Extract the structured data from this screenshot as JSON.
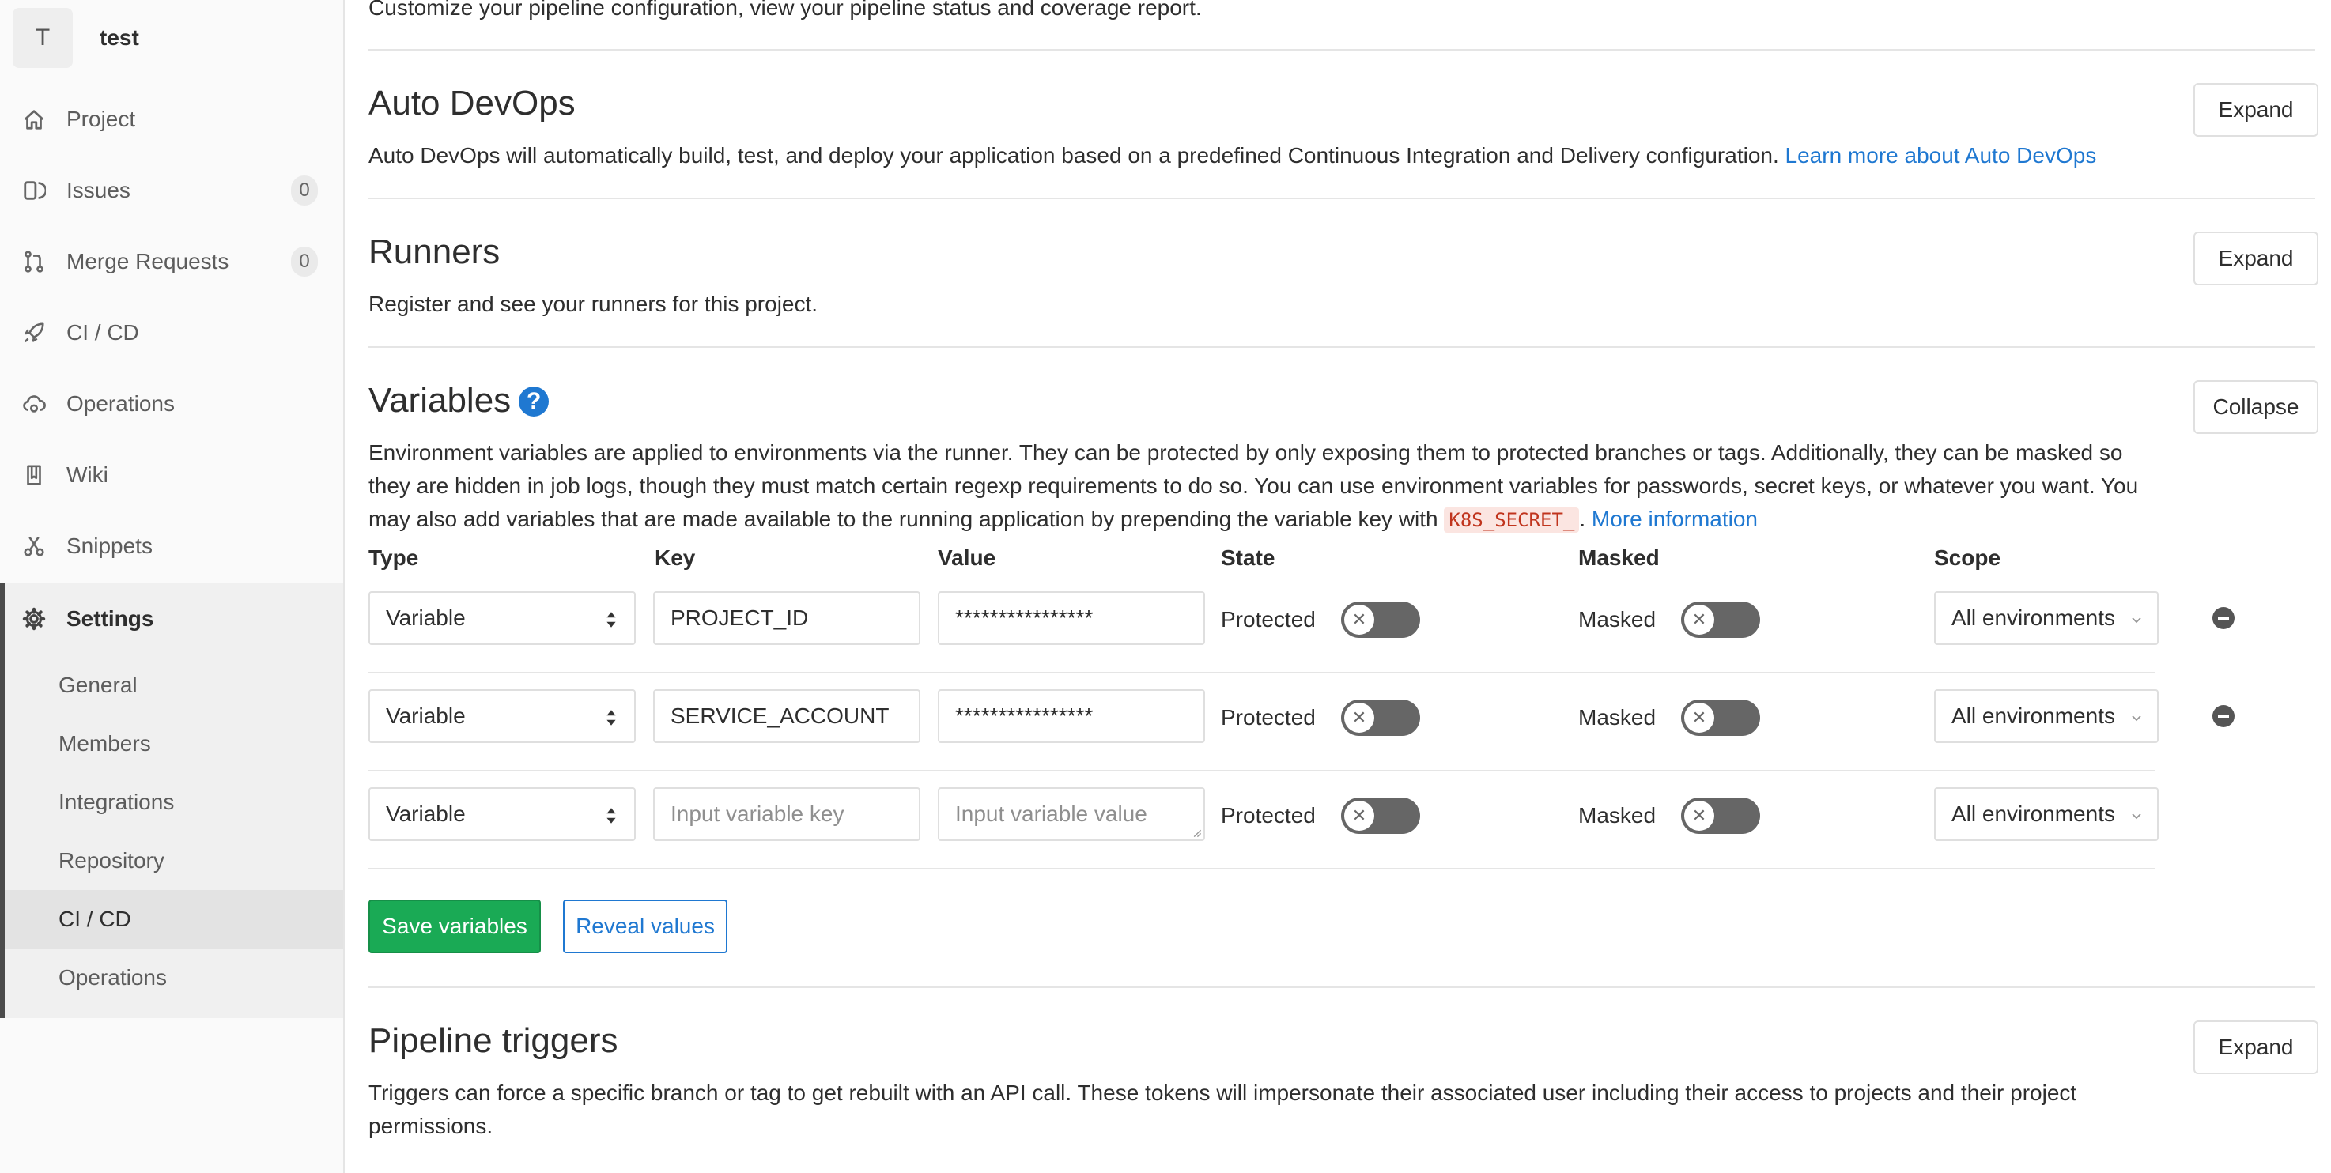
{
  "project": {
    "avatar_letter": "T",
    "name": "test"
  },
  "sidebar": {
    "items": [
      {
        "label": "Project",
        "icon": "home-icon"
      },
      {
        "label": "Issues",
        "icon": "issues-icon",
        "badge": "0"
      },
      {
        "label": "Merge Requests",
        "icon": "merge-request-icon",
        "badge": "0"
      },
      {
        "label": "CI / CD",
        "icon": "rocket-icon"
      },
      {
        "label": "Operations",
        "icon": "cloud-gear-icon"
      },
      {
        "label": "Wiki",
        "icon": "book-icon"
      },
      {
        "label": "Snippets",
        "icon": "scissors-icon"
      },
      {
        "label": "Settings",
        "icon": "gear-icon"
      }
    ],
    "settings_sub": [
      "General",
      "Members",
      "Integrations",
      "Repository",
      "CI / CD",
      "Operations"
    ]
  },
  "main": {
    "top_description": "Customize your pipeline configuration, view your pipeline status and coverage report.",
    "auto_devops": {
      "title": "Auto DevOps",
      "description": "Auto DevOps will automatically build, test, and deploy your application based on a predefined Continuous Integration and Delivery configuration.",
      "link": "Learn more about Auto DevOps",
      "button": "Expand"
    },
    "runners": {
      "title": "Runners",
      "description": "Register and see your runners for this project.",
      "button": "Expand"
    },
    "variables": {
      "title": "Variables",
      "description_1": "Environment variables are applied to environments via the runner. They can be protected by only exposing them to protected branches or tags. Additionally, they can be masked so",
      "description_2": "they are hidden in job logs, though they must match certain regexp requirements to do so. You can use environment variables for passwords, secret keys, or whatever you want. You",
      "description_3": "may also add variables that are made available to the running application by prepending the variable key with",
      "code": "K8S_SECRET_",
      "period": ".",
      "link": "More information",
      "button": "Collapse",
      "columns": [
        "Type",
        "Key",
        "Value",
        "State",
        "Masked",
        "Scope"
      ],
      "rows": [
        {
          "type": "Variable",
          "key": "PROJECT_ID",
          "value": "****************",
          "protected": "Protected",
          "masked": "Masked",
          "scope": "All environments"
        },
        {
          "type": "Variable",
          "key": "SERVICE_ACCOUNT",
          "value": "****************",
          "protected": "Protected",
          "masked": "Masked",
          "scope": "All environments"
        },
        {
          "type": "Variable",
          "key_placeholder": "Input variable key",
          "value_placeholder": "Input variable value",
          "protected": "Protected",
          "masked": "Masked",
          "scope": "All environments"
        }
      ],
      "save_button": "Save variables",
      "reveal_button": "Reveal values"
    },
    "pipeline_triggers": {
      "title": "Pipeline triggers",
      "description_1": "Triggers can force a specific branch or tag to get rebuilt with an API call. These tokens will impersonate their associated user including their access to projects and their project",
      "description_2": "permissions.",
      "button": "Expand"
    }
  },
  "colors": {
    "link": "#1f78d1",
    "success": "#1aaa55",
    "toggle_off": "#666666"
  }
}
